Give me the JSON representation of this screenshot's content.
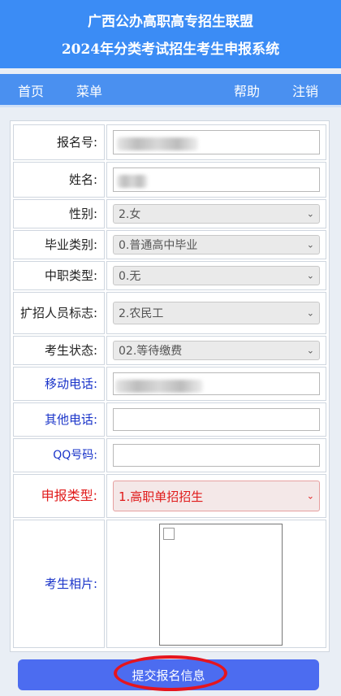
{
  "header": {
    "line1": "广西公办高职高专招生联盟",
    "line2": "2024年分类考试招生考生申报系统"
  },
  "nav": {
    "home": "首页",
    "menu": "菜单",
    "help": "帮助",
    "logout": "注销"
  },
  "form": {
    "reg_no_label": "报名号:",
    "name_label": "姓名:",
    "gender_label": "性别:",
    "gender_value": "2.女",
    "grad_type_label": "毕业类别:",
    "grad_type_value": "0.普通高中毕业",
    "voc_type_label": "中职类型:",
    "voc_type_value": "0.无",
    "expand_label": "扩招人员标志:",
    "expand_value": "2.农民工",
    "status_label": "考生状态:",
    "status_value": "02.等待缴费",
    "mobile_label": "移动电话:",
    "other_phone_label": "其他电话:",
    "qq_label": "QQ号码:",
    "apply_type_label": "申报类型:",
    "apply_type_value": "1.高职单招招生",
    "photo_label": "考生相片:"
  },
  "submit_label": "提交报名信息",
  "colors": {
    "accent": "#3b8cf5",
    "button": "#4c6cf0",
    "highlight": "#e5151e"
  }
}
